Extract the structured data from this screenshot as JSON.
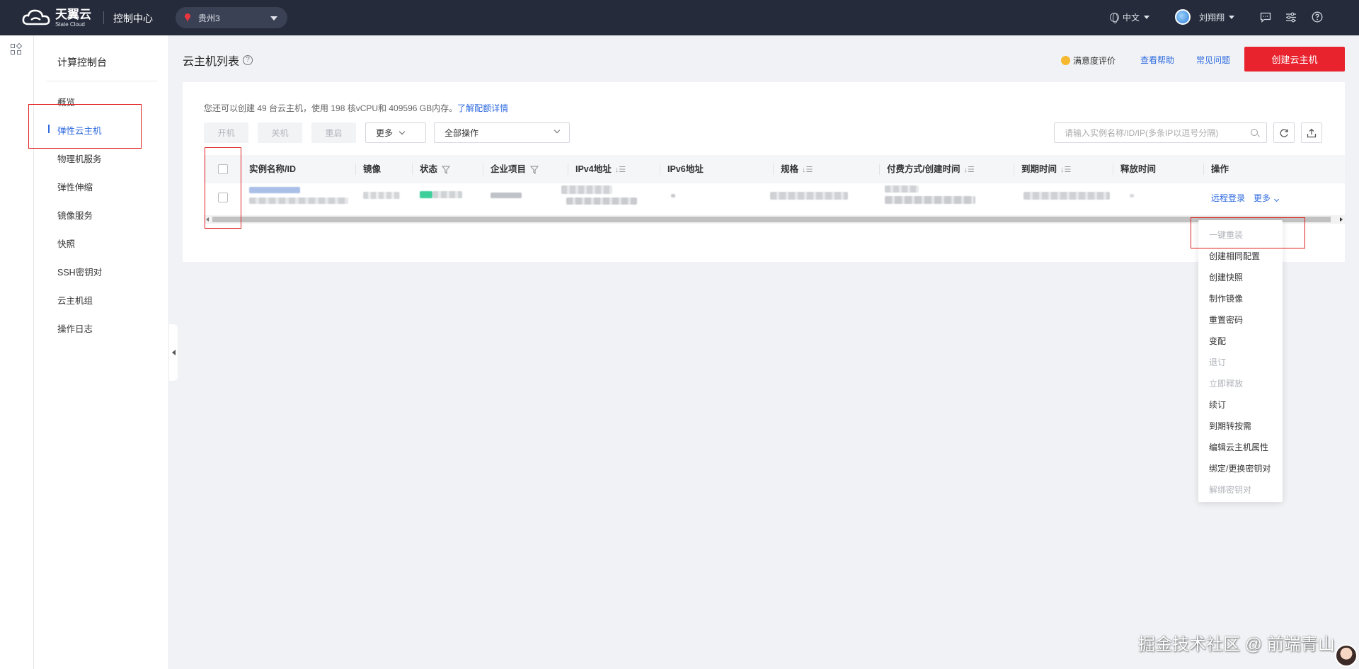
{
  "topbar": {
    "logo_main": "天翼云",
    "logo_sub": "State Cloud",
    "console": "控制中心",
    "region": "贵州3",
    "language": "中文",
    "username": "刘翔翔"
  },
  "sidemenu": {
    "title": "计算控制台",
    "items": [
      {
        "label": "概览",
        "active": false
      },
      {
        "label": "弹性云主机",
        "active": true
      },
      {
        "label": "物理机服务",
        "active": false
      },
      {
        "label": "弹性伸缩",
        "active": false
      },
      {
        "label": "镜像服务",
        "active": false
      },
      {
        "label": "快照",
        "active": false
      },
      {
        "label": "SSH密钥对",
        "active": false
      },
      {
        "label": "云主机组",
        "active": false
      },
      {
        "label": "操作日志",
        "active": false
      }
    ]
  },
  "header": {
    "title": "云主机列表",
    "satisfaction": "满意度评价",
    "help": "查看帮助",
    "faq": "常见问题",
    "create_button": "创建云主机"
  },
  "quota": {
    "text": "您还可以创建 49 台云主机，使用 198 核vCPU和 409596 GB内存。",
    "link": "了解配额详情"
  },
  "toolbar": {
    "start": "开机",
    "stop": "关机",
    "restart": "重启",
    "more": "更多",
    "all_ops": "全部操作",
    "search_placeholder": "请输入实例名称/ID/IP(多条IP以逗号分隔)"
  },
  "table": {
    "columns": [
      "实例名称/ID",
      "镜像",
      "状态",
      "企业项目",
      "IPv4地址",
      "IPv6地址",
      "规格",
      "付费方式/创建时间",
      "到期时间",
      "释放时间",
      "操作"
    ],
    "row_actions": {
      "remote_login": "远程登录",
      "more": "更多"
    }
  },
  "dropdown": {
    "items": [
      {
        "label": "一键重装",
        "disabled": true
      },
      {
        "label": "创建相同配置",
        "disabled": false
      },
      {
        "label": "创建快照",
        "disabled": false
      },
      {
        "label": "制作镜像",
        "disabled": false
      },
      {
        "label": "重置密码",
        "disabled": false
      },
      {
        "label": "变配",
        "disabled": false
      },
      {
        "label": "退订",
        "disabled": true
      },
      {
        "label": "立即释放",
        "disabled": true
      },
      {
        "label": "续订",
        "disabled": false
      },
      {
        "label": "到期转按需",
        "disabled": false
      },
      {
        "label": "编辑云主机属性",
        "disabled": false
      },
      {
        "label": "绑定/更换密钥对",
        "disabled": false
      },
      {
        "label": "解绑密钥对",
        "disabled": true
      }
    ]
  },
  "watermark": "掘金技术社区 @ 前端青山",
  "colors": {
    "topbar": "#252b3a",
    "accent_blue": "#2f6be0",
    "brand_red": "#e8232e",
    "highlight_red": "#e02020"
  }
}
